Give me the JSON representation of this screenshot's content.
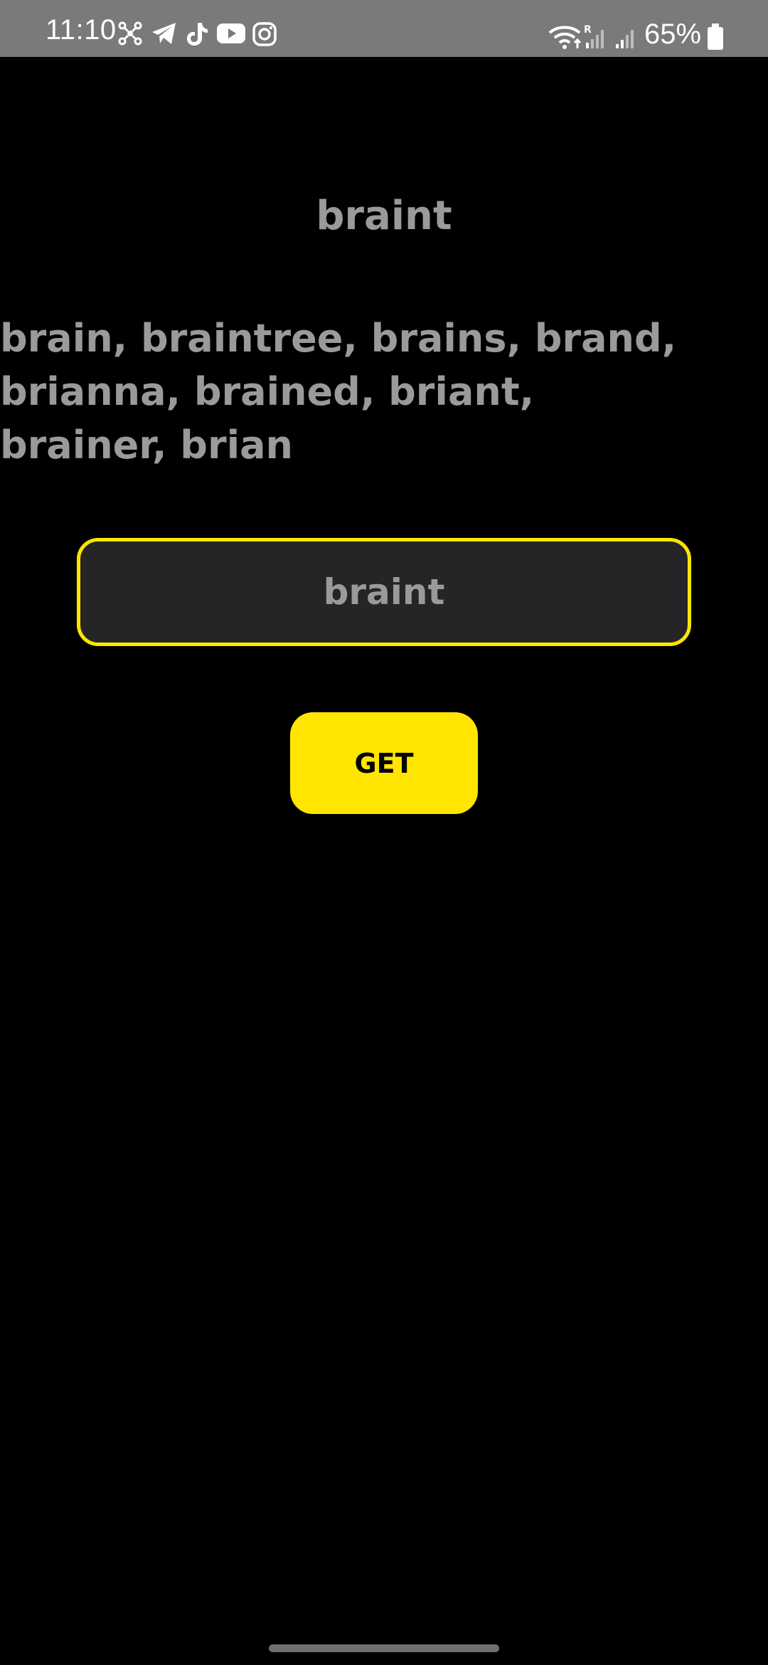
{
  "status_bar": {
    "time": "11:10",
    "battery": "65%",
    "left_icons": [
      "network-icon",
      "telegram-icon",
      "tiktok-icon",
      "youtube-icon",
      "instagram-icon"
    ],
    "right_icons": [
      "wifi-icon",
      "signal-roaming-icon",
      "signal-icon",
      "battery-icon"
    ],
    "background": "#7a7a7a"
  },
  "main": {
    "title": "braint",
    "suggestions": "brain, braintree, brains, brand, brianna, brained, briant, brainer, brian",
    "input_value": "braint",
    "get_label": "GET"
  },
  "colors": {
    "accent": "#ffe500",
    "text": "#9a9a9a",
    "background": "#000000",
    "input_background": "#252426"
  }
}
